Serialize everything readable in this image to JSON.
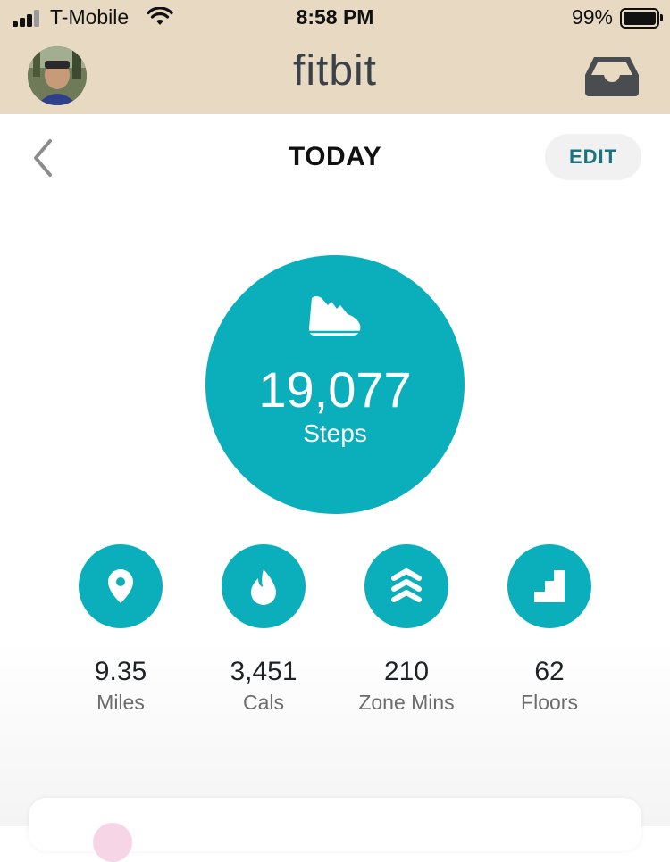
{
  "status_bar": {
    "carrier": "T-Mobile",
    "time": "8:58 PM",
    "battery_percent": "99%",
    "battery_level": 0.99,
    "signal_icon": "cellular-signal-icon",
    "wifi_icon": "wifi-icon",
    "battery_icon": "battery-icon"
  },
  "app_bar": {
    "brand": "fitbit",
    "avatar_icon": "profile-avatar",
    "inbox_icon": "inbox-icon",
    "background_color": "#e7d9c2"
  },
  "nav": {
    "back_icon": "chevron-left-icon",
    "title": "TODAY",
    "edit_label": "EDIT"
  },
  "steps": {
    "icon": "shoe-icon",
    "value": "19,077",
    "label": "Steps",
    "color": "#0aafbb"
  },
  "stats": [
    {
      "icon": "location-pin-icon",
      "value": "9.35",
      "label": "Miles"
    },
    {
      "icon": "flame-icon",
      "value": "3,451",
      "label": "Cals"
    },
    {
      "icon": "zone-chevrons-icon",
      "value": "210",
      "label": "Zone Mins"
    },
    {
      "icon": "stairs-icon",
      "value": "62",
      "label": "Floors"
    }
  ],
  "accent_color": "#0aafbb"
}
